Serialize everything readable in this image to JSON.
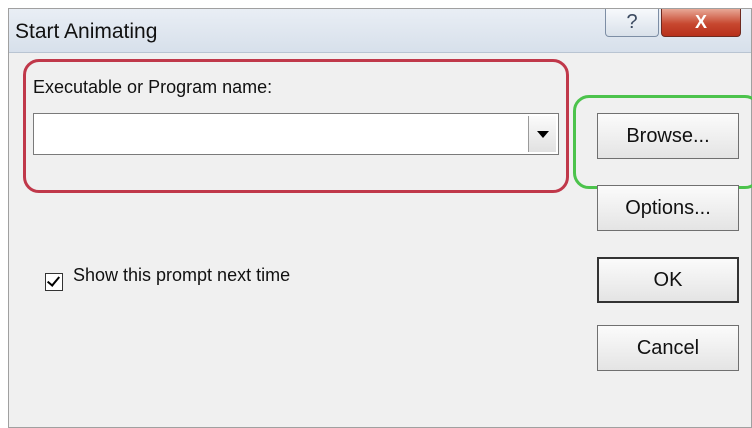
{
  "window": {
    "title": "Start Animating",
    "help_label": "?",
    "close_label": "X"
  },
  "form": {
    "program_label": "Executable or Program name:",
    "program_value": "",
    "show_prompt_label": "Show this prompt next time",
    "show_prompt_checked": true
  },
  "buttons": {
    "browse": "Browse...",
    "options": "Options...",
    "ok": "OK",
    "cancel": "Cancel"
  },
  "highlights": {
    "red": "#c0384a",
    "green": "#4cc34c"
  }
}
